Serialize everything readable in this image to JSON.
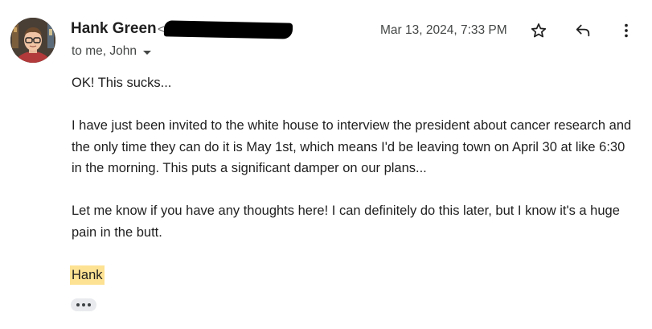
{
  "sender": {
    "name": "Hank Green",
    "email_fragment": "<",
    "avatar_icon": "profile-photo"
  },
  "recipients": {
    "label": "to me, John"
  },
  "timestamp": "Mar 13, 2024, 7:33 PM",
  "actions": {
    "star_icon": "star-icon",
    "reply_icon": "reply-icon",
    "more_icon": "more-vert-icon"
  },
  "message": {
    "paragraph_1": "OK! This sucks...",
    "paragraph_2": "I have just been invited to the white house to interview the president about cancer research and the only time they can do it is May 1st, which means I'd be leaving town on April 30 at like 6:30 in the morning. This puts a significant damper on our plans...",
    "paragraph_3": "Let me know if you have any thoughts here! I can definitely do this later, but I know it's a huge pain in the butt.",
    "signature": "Hank"
  },
  "colors": {
    "signature_highlight": "#fde293",
    "primary_text": "#1f1f1f",
    "secondary_text": "#444746"
  }
}
